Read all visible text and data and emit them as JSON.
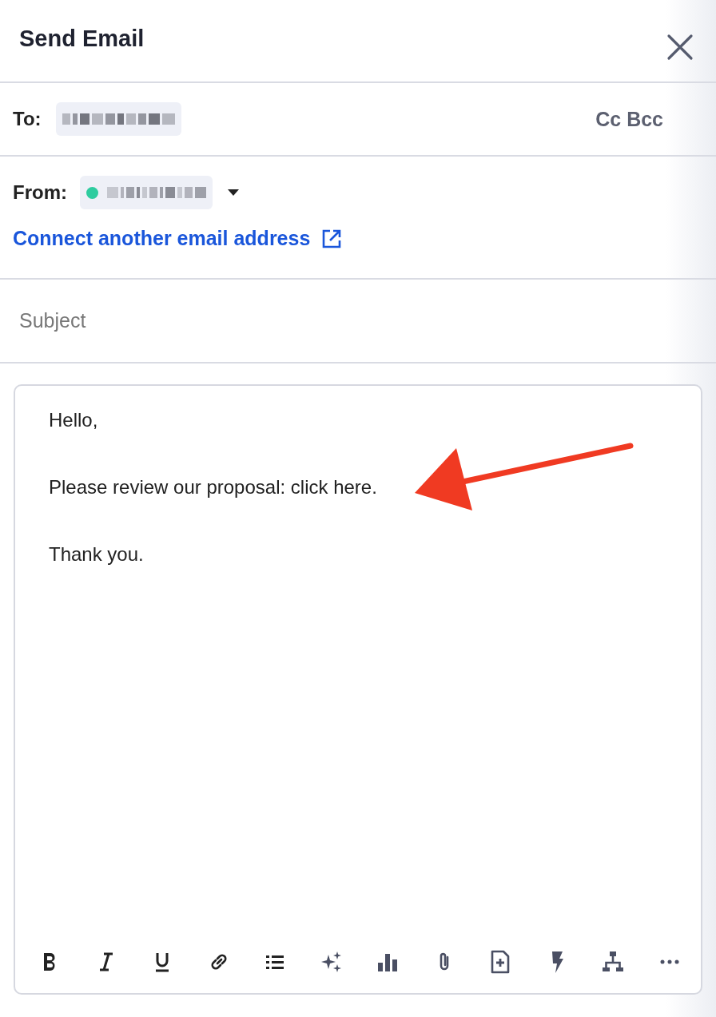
{
  "header": {
    "title": "Send Email"
  },
  "to": {
    "label": "To:",
    "redacted": true,
    "cc_bcc": "Cc Bcc"
  },
  "from": {
    "label": "From:",
    "redacted": true,
    "link": "Connect another email address"
  },
  "subject": {
    "placeholder": "Subject"
  },
  "body": {
    "paragraphs": [
      "Hello,",
      "Please review our proposal: click here.",
      "Thank you."
    ]
  },
  "toolbar": [
    {
      "kind": "bold"
    },
    {
      "kind": "italic"
    },
    {
      "kind": "underline"
    },
    {
      "kind": "link"
    },
    {
      "kind": "list"
    },
    {
      "kind": "sparkle"
    },
    {
      "kind": "chart"
    },
    {
      "kind": "attach"
    },
    {
      "kind": "doc"
    },
    {
      "kind": "bolt"
    },
    {
      "kind": "tree"
    },
    {
      "kind": "more"
    }
  ]
}
